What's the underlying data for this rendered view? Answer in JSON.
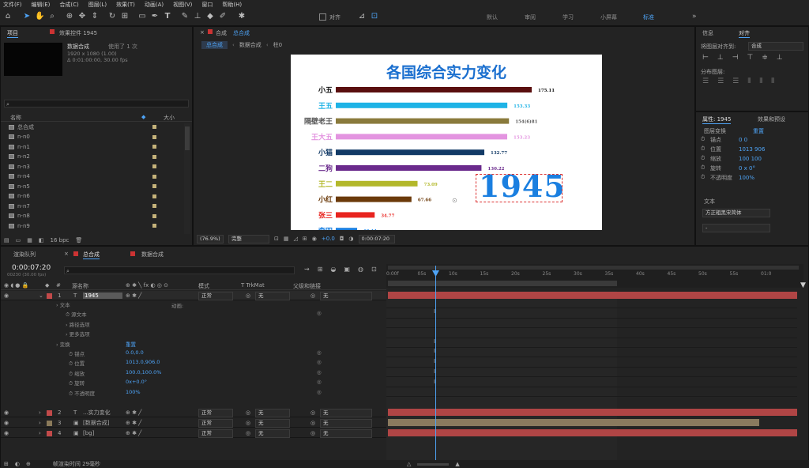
{
  "menu": [
    "文件(F)",
    "编辑(E)",
    "合成(C)",
    "图层(L)",
    "效果(T)",
    "动画(A)",
    "视图(V)",
    "窗口",
    "帮助(H)"
  ],
  "toolbar": {
    "snap_label": "对齐"
  },
  "workspaces": [
    "默认",
    "审阅",
    "学习",
    "小屏幕",
    "标准"
  ],
  "project": {
    "tab": "项目",
    "effects_tab": "效果控件 1945",
    "item_name": "数据合成",
    "item_uses": "使用了 1 次",
    "item_info1": "1920 x 1080 (1.00)",
    "item_info2": "Δ 0:01:00:00, 30.00 fps",
    "col_name": "名称",
    "col_size": "大小",
    "items": [
      "总合成",
      "n-n0",
      "n-n1",
      "n-n2",
      "n-n3",
      "n-n4",
      "n-n5",
      "n-n6",
      "n-n7",
      "n-n8",
      "n-n9"
    ],
    "bpc": "16 bpc"
  },
  "viewer": {
    "tab_label": "合成",
    "tab_name": "总合成",
    "crumbs": [
      "总合成",
      "数据合成",
      "柱0"
    ],
    "zoom": "(76.9%)",
    "quality": "完整",
    "timecode": "0:00:07:20",
    "exposure": "+0.0"
  },
  "chart_data": {
    "type": "bar",
    "title": "各国综合实力变化",
    "year": "1945",
    "categories": [
      "小五",
      "王五",
      "隔壁老王",
      "王大五",
      "小猫",
      "二狗",
      "王二",
      "小红",
      "张三",
      "李四"
    ],
    "values": [
      175.11,
      153.33,
      154.81,
      153.23,
      132.77,
      130.22,
      73.09,
      67.66,
      34.77,
      19.11
    ],
    "value_labels": [
      "175.11",
      "153.33",
      "154(6)81",
      "153.23",
      "132.77",
      "130.22",
      "73.09",
      "67.66",
      "34.77",
      "19.11"
    ],
    "colors": [
      "#5a0f0f",
      "#1fb3e6",
      "#8a7a3c",
      "#e394e0",
      "#123a66",
      "#6a2a8c",
      "#b3b82a",
      "#6b3a0a",
      "#e8241f",
      "#1a7fe0"
    ],
    "label_colors": [
      "#111",
      "#1fb3e6",
      "#555",
      "#e394e0",
      "#123a66",
      "#6a2a8c",
      "#b3b82a",
      "#6b3a0a",
      "#e8241f",
      "#1a7fe0"
    ],
    "xlim": [
      0,
      175.11
    ]
  },
  "right": {
    "tabs": [
      "信息",
      "对齐"
    ],
    "align_to_label": "将图层对齐到:",
    "align_to_value": "合成",
    "distribute": "分布图层:",
    "props_tab": "属性: 1945",
    "effects_tab": "效果和预设",
    "layer_transform": "图层变换",
    "reset": "重置",
    "props": [
      {
        "name": "锚点",
        "v": "0    0"
      },
      {
        "name": "位置",
        "v": "1013  906"
      },
      {
        "name": "缩放",
        "v": "100  100"
      },
      {
        "name": "旋转",
        "v": "0 x 0°"
      },
      {
        "name": "不透明度",
        "v": "100%"
      }
    ],
    "text_label": "文本",
    "font": "方正粗黑宋简体",
    "font_style": "-"
  },
  "timeline": {
    "tabs": [
      "渲染队列",
      "总合成",
      "数据合成"
    ],
    "timecode": "0:00:07:20",
    "fps_info": "00230 (30.00 fps)",
    "ticks": [
      "0:00f",
      "05s",
      "10s",
      "15s",
      "20s",
      "25s",
      "30s",
      "35s",
      "40s",
      "45s",
      "50s",
      "55s",
      "01:0"
    ],
    "col_name": "源名称",
    "col_mode": "模式",
    "col_trkmat": "T  TrkMat",
    "col_parent": "父级和链接",
    "layers": [
      {
        "num": "1",
        "name": "1945",
        "mode": "正常",
        "trk": "无",
        "parent": "无",
        "color": "#c24a4a"
      },
      {
        "num": "2",
        "name": "...实力变化",
        "mode": "正常",
        "trk": "无",
        "parent": "无",
        "color": "#c24a4a"
      },
      {
        "num": "3",
        "name": "[数据合成]",
        "mode": "正常",
        "trk": "无",
        "parent": "无",
        "color": "#8a7a5a"
      },
      {
        "num": "4",
        "name": "[bg]",
        "mode": "正常",
        "trk": "无",
        "parent": "无",
        "color": "#c24a4a"
      }
    ],
    "props": [
      {
        "name": "文本",
        "v": ""
      },
      {
        "name": "源文本",
        "v": ""
      },
      {
        "name": "路径选项",
        "v": ""
      },
      {
        "name": "更多选项",
        "v": ""
      },
      {
        "name": "变换",
        "v": "重置"
      },
      {
        "name": "锚点",
        "v": "0.0,0.0"
      },
      {
        "name": "位置",
        "v": "1013.0,906.0"
      },
      {
        "name": "缩放",
        "v": "100.0,100.0%"
      },
      {
        "name": "旋转",
        "v": "0x+0.0°"
      },
      {
        "name": "不透明度",
        "v": "100%"
      }
    ],
    "animate_label": "动画:",
    "toggle_label": "切换开关/模式",
    "render_time": "帧渲染时间 29毫秒"
  }
}
